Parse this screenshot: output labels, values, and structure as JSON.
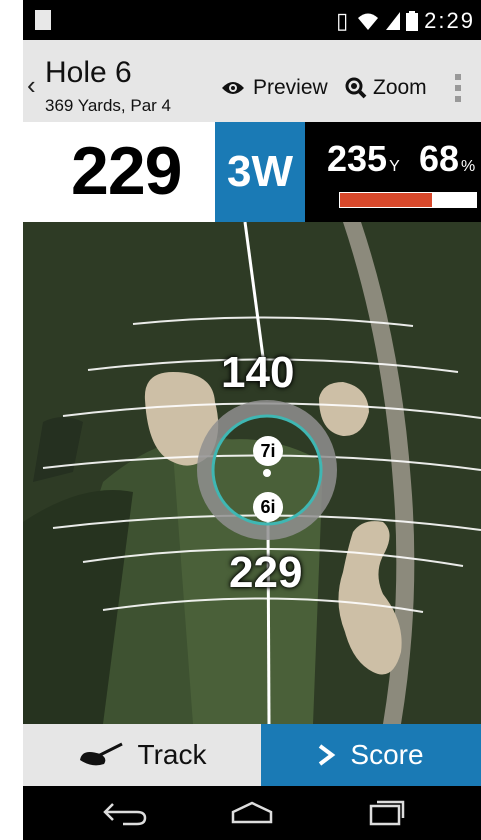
{
  "status_bar": {
    "time": "2:29"
  },
  "header": {
    "hole_title": "Hole 6",
    "hole_subtitle": "369 Yards, Par 4",
    "preview_label": "Preview",
    "zoom_label": "Zoom"
  },
  "distance_bar": {
    "distance": "229",
    "club": "3W",
    "club_yards": "235",
    "club_yards_unit": "Y",
    "percent": "68",
    "percent_unit": "%",
    "power_fraction": 0.68,
    "power_color": "#d8492c"
  },
  "map": {
    "labels": {
      "upper": "140",
      "lower": "229"
    },
    "club_markers": [
      "7i",
      "6i"
    ]
  },
  "actions": {
    "track_label": "Track",
    "score_label": "Score"
  },
  "colors": {
    "accent": "#1a7ab5",
    "ring": "#3fb7b3"
  },
  "icons": [
    "notification-icon",
    "vibrate-icon",
    "wifi-icon",
    "signal-icon",
    "battery-icon",
    "back-chevron-icon",
    "eye-icon",
    "magnifier-icon",
    "overflow-menu-icon",
    "golf-club-icon",
    "chevron-right-icon",
    "nav-back-icon",
    "nav-home-icon",
    "nav-recents-icon"
  ]
}
